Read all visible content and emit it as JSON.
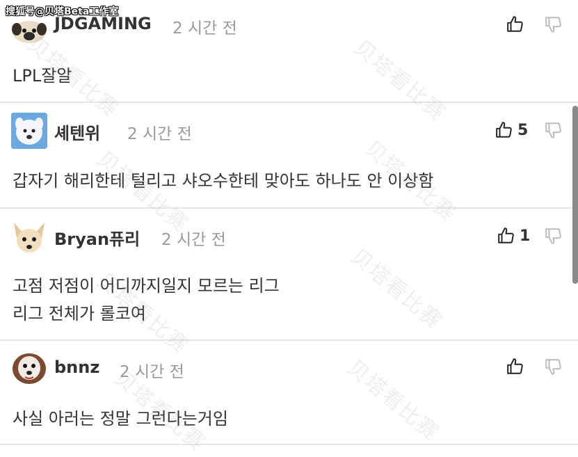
{
  "source_tag": "搜狐号@贝塔Beta工作室",
  "watermark_text": "贝塔看比赛",
  "comments": [
    {
      "avatar": "pug-dog-avatar",
      "username": "JDGAMING",
      "time": "2 시간 전",
      "likes": "",
      "lines": [
        "LPL잘알"
      ]
    },
    {
      "avatar": "white-dog-avatar",
      "username": "셰텐위",
      "time": "2 시간 전",
      "likes": "5",
      "lines": [
        "갑자기 해리한테 털리고 샤오수한테 맞아도 하나도 안 이상함"
      ]
    },
    {
      "avatar": "chihuahua-avatar",
      "username": "Bryan퓨리",
      "time": "2 시간 전",
      "likes": "1",
      "lines": [
        "고점 저점이 어디까지일지 모르는 리그",
        "리그 전체가 롤코여"
      ]
    },
    {
      "avatar": "shih-tzu-avatar",
      "username": "bnnz",
      "time": "2 시간 전",
      "likes": "",
      "lines": [
        "사실 아러는 정말 그런다는거임"
      ]
    }
  ],
  "icons": {
    "like": "thumbs-up-icon",
    "dislike": "thumbs-down-icon"
  },
  "colors": {
    "text": "#333333",
    "muted": "#9a9a9a",
    "divider": "#e6e6e6"
  }
}
